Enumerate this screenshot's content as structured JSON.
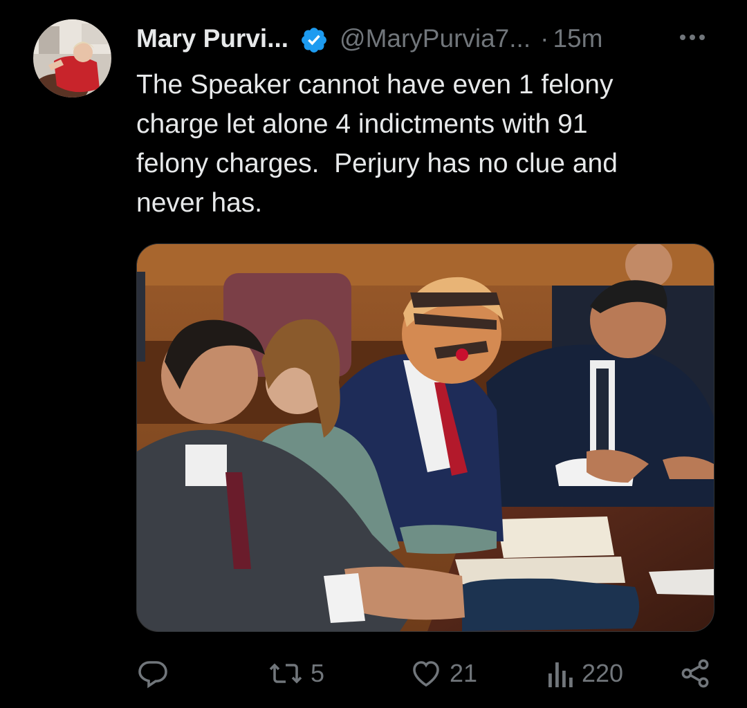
{
  "tweet": {
    "author_name": "Mary Purvi...",
    "author_handle": "@MaryPurvia7...",
    "separator": "·",
    "time_ago": "15m",
    "verified": true,
    "text": "The Speaker cannot have even 1 felony\ncharge let alone 4 indictments with 91\nfelony charges.  Perjury has no clue and\nnever has."
  },
  "actions": {
    "reply_count": "",
    "retweet_count": "5",
    "like_count": "21",
    "views_count": "220"
  },
  "colors": {
    "background": "#000000",
    "text_primary": "#e7e9ea",
    "text_secondary": "#71767b",
    "verified_badge": "#1d9bf0"
  },
  "icons": {
    "reply": "reply-icon",
    "retweet": "retweet-icon",
    "like": "heart-icon",
    "views": "views-chart-icon",
    "share": "share-icon",
    "more": "more-options-icon",
    "verified": "verified-badge-icon"
  }
}
